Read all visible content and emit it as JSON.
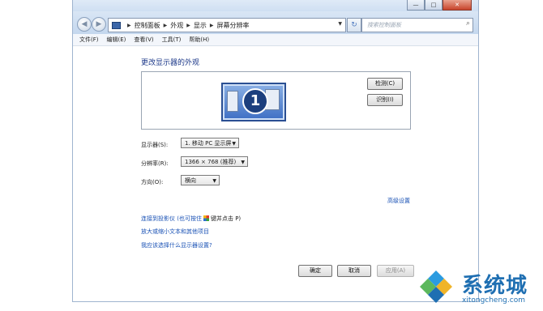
{
  "titlebar": {
    "buttons": [
      {
        "name": "minimize-icon",
        "glyph": "—"
      },
      {
        "name": "maximize-icon",
        "glyph": "□"
      },
      {
        "name": "close-icon",
        "glyph": "✕"
      }
    ]
  },
  "nav": {
    "back": "◀",
    "forward": "▶",
    "refresh": "⁴₊",
    "search_glyph": "⌕"
  },
  "breadcrumb": [
    "控制面板",
    "外观",
    "显示",
    "屏幕分辨率"
  ],
  "search": {
    "placeholder": "搜索控制面板"
  },
  "menu": [
    "文件(F)",
    "编辑(E)",
    "查看(V)",
    "工具(T)",
    "帮助(H)"
  ],
  "page": {
    "heading": "更改显示器的外观",
    "monitor_number": "1",
    "detect_button": "检测(C)",
    "identify_button": "识别(I)"
  },
  "settings": {
    "display_label": "显示器(S):",
    "display_value": "1. 移动 PC 显示屏",
    "resolution_label": "分辨率(R):",
    "resolution_value": "1366 × 768 (推荐)",
    "orientation_label": "方向(O):",
    "orientation_value": "横向",
    "advanced_link": "高级设置"
  },
  "links": {
    "projector_prefix": "连接到投影仪 (也可按住",
    "projector_suffix": "键并点击 P)",
    "text_size": "放大或缩小文本和其他项目",
    "which_settings": "我应该选择什么显示器设置?"
  },
  "footer": {
    "ok": "确定",
    "cancel": "取消",
    "apply": "应用(A)"
  },
  "watermark": {
    "title": "系统城",
    "url": "xitongcheng.com"
  },
  "colors": {
    "link": "#1a52b5",
    "heading": "#1e3a8a",
    "watermark": "#1f6fb2"
  }
}
